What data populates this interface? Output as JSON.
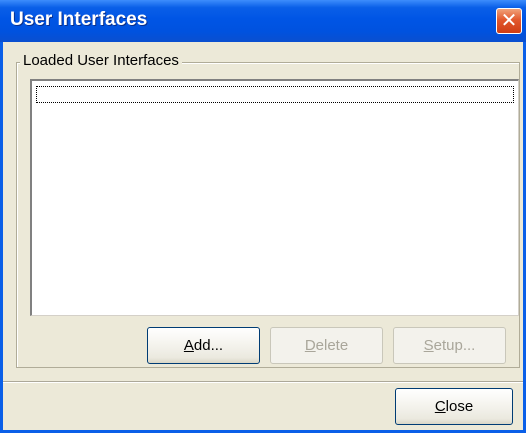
{
  "window": {
    "title": "User Interfaces",
    "close_glyph": "✕"
  },
  "group": {
    "legend": "Loaded User Interfaces"
  },
  "list": {
    "items": []
  },
  "buttons": {
    "add": {
      "prefix": "",
      "accel": "A",
      "rest": "dd...",
      "enabled": true
    },
    "delete": {
      "prefix": "",
      "accel": "D",
      "rest": "elete",
      "enabled": false
    },
    "setup": {
      "prefix": "",
      "accel": "S",
      "rest": "etup...",
      "enabled": false
    },
    "close": {
      "prefix": "",
      "accel": "C",
      "rest": "lose",
      "enabled": true
    }
  },
  "colors": {
    "titlebar": "#0a5fe8",
    "dialog_bg": "#ece9d8",
    "close_button": "#e2582d"
  },
  "icons": {
    "close": "close-icon"
  }
}
